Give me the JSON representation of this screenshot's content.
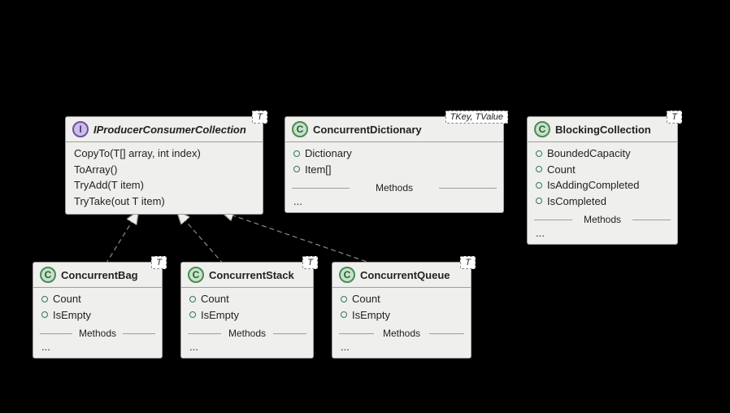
{
  "interface": {
    "icon_letter": "I",
    "name": "IProducerConsumerCollection",
    "type_param": "T",
    "methods": [
      "CopyTo(T[] array, int index)",
      "ToArray()",
      "TryAdd(T item)",
      "TryTake(out T item)"
    ]
  },
  "dictionary": {
    "icon_letter": "C",
    "name": "ConcurrentDictionary",
    "type_param": "TKey, TValue",
    "properties": [
      "Dictionary",
      "Item[]"
    ],
    "section_label": "Methods",
    "ellipsis": "..."
  },
  "blocking": {
    "icon_letter": "C",
    "name": "BlockingCollection",
    "type_param": "T",
    "properties": [
      "BoundedCapacity",
      "Count",
      "IsAddingCompleted",
      "IsCompleted"
    ],
    "section_label": "Methods",
    "ellipsis": "..."
  },
  "bag": {
    "icon_letter": "C",
    "name": "ConcurrentBag",
    "type_param": "T",
    "properties": [
      "Count",
      "IsEmpty"
    ],
    "section_label": "Methods",
    "ellipsis": "..."
  },
  "stack": {
    "icon_letter": "C",
    "name": "ConcurrentStack",
    "type_param": "T",
    "properties": [
      "Count",
      "IsEmpty"
    ],
    "section_label": "Methods",
    "ellipsis": "..."
  },
  "queue": {
    "icon_letter": "C",
    "name": "ConcurrentQueue",
    "type_param": "T",
    "properties": [
      "Count",
      "IsEmpty"
    ],
    "section_label": "Methods",
    "ellipsis": "..."
  }
}
